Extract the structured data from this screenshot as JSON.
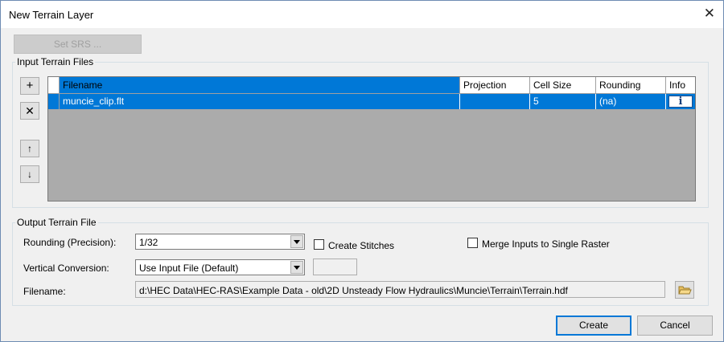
{
  "window": {
    "title": "New Terrain Layer",
    "close_glyph": "✕"
  },
  "set_srs": {
    "label": "Set SRS ..."
  },
  "input_group": {
    "label": "Input Terrain Files",
    "buttons": {
      "add": "+",
      "remove": "✕",
      "up": "↑",
      "down": "↓"
    },
    "columns": [
      "Filename",
      "Projection",
      "Cell Size",
      "Rounding",
      "Info"
    ],
    "rows": [
      {
        "filename": "muncie_clip.flt",
        "projection": "",
        "cell_size": "5",
        "rounding": "(na)",
        "info": "i"
      }
    ]
  },
  "output_group": {
    "label": "Output Terrain File",
    "rounding_label": "Rounding (Precision):",
    "rounding_value": "1/32",
    "create_stitches_label": "Create Stitches",
    "merge_label": "Merge Inputs to Single Raster",
    "vertical_label": "Vertical Conversion:",
    "vertical_value": "Use Input File (Default)",
    "vertical_extra_value": "",
    "filename_label": "Filename:",
    "filename_value": "d:\\HEC Data\\HEC-RAS\\Example Data - old\\2D Unsteady Flow Hydraulics\\Muncie\\Terrain\\Terrain.hdf"
  },
  "footer": {
    "create": "Create",
    "cancel": "Cancel"
  },
  "colors": {
    "selection": "#0078d7",
    "grid_bg": "#ababab"
  },
  "icons": {
    "browse": "folder-icon",
    "info": "info-icon"
  }
}
